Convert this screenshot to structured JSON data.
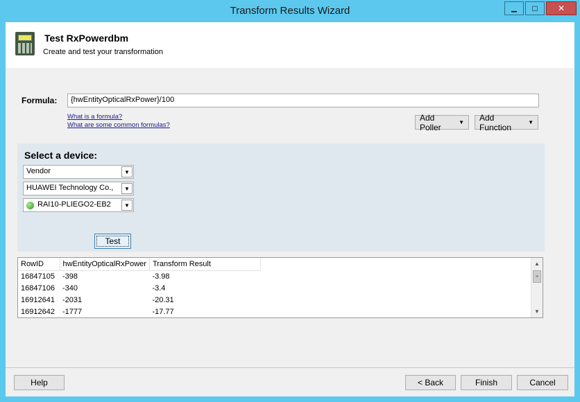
{
  "window": {
    "title": "Transform Results Wizard",
    "minimize_glyph": "▁",
    "maximize_glyph": "□",
    "close_glyph": "✕"
  },
  "header": {
    "icon": "calculator-icon",
    "title": "Test RxPowerdbm",
    "subtitle": "Create and test your transformation"
  },
  "formula": {
    "label": "Formula:",
    "value": "{hwEntityOpticalRxPower}/100",
    "link_what": "What is a formula?",
    "link_common": "What are some common formulas?",
    "add_poller": "Add Poller",
    "add_function": "Add Function",
    "dropdown_arrow": "▼"
  },
  "device": {
    "title": "Select a device:",
    "filter_type": "Vendor",
    "vendor": "HUAWEI Technology Co.,",
    "node": "RAI10-PLIEGO2-EB2",
    "node_status_color": "#3fa83f",
    "test_label": "Test"
  },
  "results": {
    "columns": [
      "RowID",
      "hwEntityOpticalRxPower",
      "Transform Result"
    ],
    "rows": [
      [
        "16847105",
        "-398",
        "-3.98"
      ],
      [
        "16847106",
        "-340",
        "-3.4"
      ],
      [
        "16912641",
        "-2031",
        "-20.31"
      ],
      [
        "16912642",
        "-1777",
        "-17.77"
      ]
    ],
    "scroll_up": "▲",
    "scroll_down": "▼",
    "thumb_grip": "≡"
  },
  "footer": {
    "help": "Help",
    "back": "< Back",
    "finish": "Finish",
    "cancel": "Cancel"
  },
  "colors": {
    "titlebar": "#5cc8ee",
    "close_button": "#c75050",
    "panel": "#dfe8ee"
  }
}
